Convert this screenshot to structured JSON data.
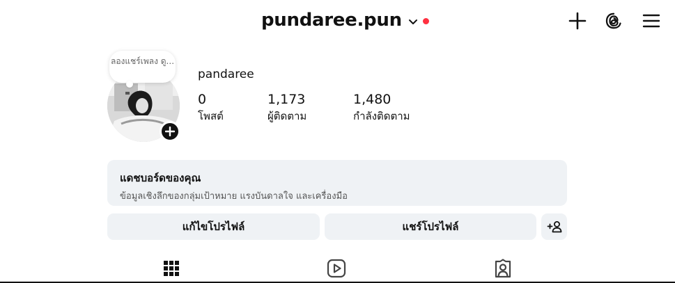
{
  "header": {
    "username": "pundaree.pun",
    "icons": {
      "create": "plus-icon",
      "threads": "threads-icon",
      "menu": "hamburger-menu-icon"
    },
    "notification_dot_color": "#ff3040"
  },
  "profile": {
    "note_text": "ลองแชร์เพลง ดู...",
    "display_name": "pandaree",
    "stats": [
      {
        "value": "0",
        "label": "โพสต์"
      },
      {
        "value": "1,173",
        "label": "ผู้ติดตาม"
      },
      {
        "value": "1,480",
        "label": "กำลังติดตาม"
      }
    ]
  },
  "dashboard": {
    "title": "แดชบอร์ดของคุณ",
    "subtitle": "ข้อมูลเชิงลึกของกลุ่มเป้าหมาย แรงบันดาลใจ และเครื่องมือ"
  },
  "actions": {
    "edit_profile": "แก้ไขโปรไฟล์",
    "share_profile": "แชร์โปรไฟล์"
  },
  "tabs": [
    {
      "icon": "grid-icon",
      "active": true
    },
    {
      "icon": "reels-icon",
      "active": false
    },
    {
      "icon": "tagged-icon",
      "active": false
    }
  ]
}
